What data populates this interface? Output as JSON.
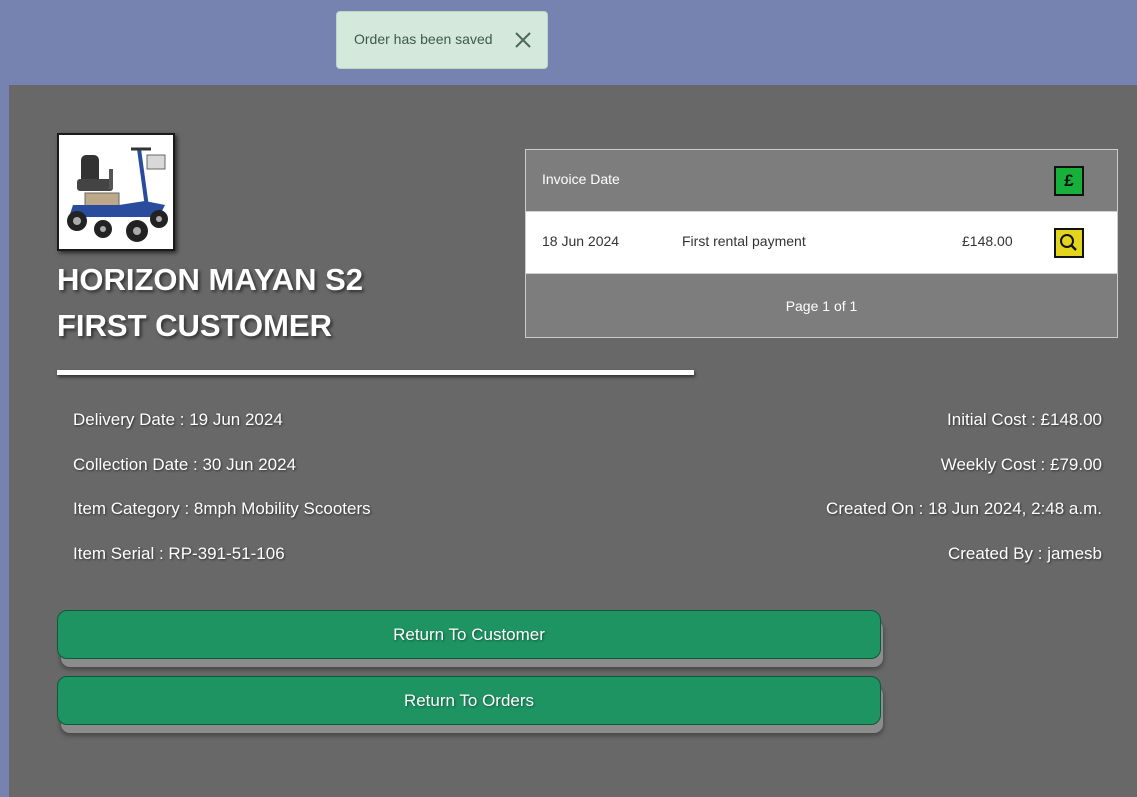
{
  "toast": {
    "message": "Order has been saved",
    "close_icon": "close-icon"
  },
  "item": {
    "image_icon": "mobility-scooter-image",
    "name": "HORIZON MAYAN S2",
    "customer": "FIRST CUSTOMER"
  },
  "invoices": {
    "header_label": "Invoice Date",
    "add_icon_symbol": "£",
    "rows": [
      {
        "date": "18 Jun 2024",
        "description": "First rental payment",
        "amount": "£148.00"
      }
    ],
    "pagination": "Page 1 of 1"
  },
  "details": {
    "delivery": "Delivery Date : 19 Jun 2024",
    "collection": "Collection Date : 30 Jun 2024",
    "category": "Item Category : 8mph Mobility Scooters",
    "serial": "Item Serial : RP-391-51-106",
    "initial_cost": "Initial Cost : £148.00",
    "weekly_cost": "Weekly Cost : £79.00",
    "created_on": "Created On : 18 Jun 2024, 2:48 a.m.",
    "created_by": "Created By : jamesb"
  },
  "actions": {
    "return_customer": "Return To Customer",
    "return_orders": "Return To Orders"
  },
  "colors": {
    "background": "#7683b0",
    "panel": "#686868",
    "button_green": "#1d9462",
    "pound_button": "#17b03a",
    "search_button": "#e3d41e",
    "toast": "#d4e8dc"
  }
}
